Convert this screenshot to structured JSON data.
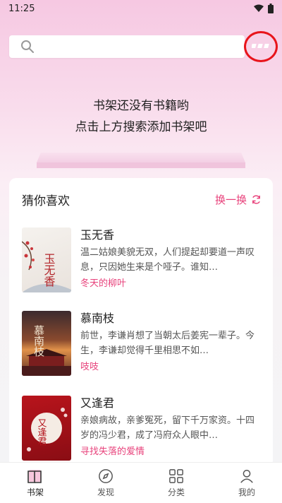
{
  "status": {
    "time": "11:25"
  },
  "search": {
    "placeholder": ""
  },
  "empty_state": {
    "line1": "书架还没有书籍哟",
    "line2": "点击上方搜索添加书架吧"
  },
  "recommend": {
    "title": "猜你喜欢",
    "refresh_label": "换一换",
    "books": [
      {
        "title": "玉无香",
        "desc": "温二姑娘美貌无双，人们提起却要道一声叹息，只因她生来是个哑子。谁知…",
        "author": "冬天的柳叶",
        "cover_text": "玉无香"
      },
      {
        "title": "慕南枝",
        "desc": "前世，李谦肖想了当朝太后姜宪一辈子。今生，李谦却觉得千里相思不如…",
        "author": "吱吱",
        "cover_text": "慕南枝"
      },
      {
        "title": "又逢君",
        "desc": "亲娘病故，亲爹冤死，留下千万家资。十四岁的冯少君，成了冯府众人眼中…",
        "author": "寻找失落的爱情",
        "cover_text": "又逢君"
      }
    ]
  },
  "tabs": [
    {
      "label": "书架",
      "icon": "book-icon",
      "active": true
    },
    {
      "label": "发现",
      "icon": "compass-icon",
      "active": false
    },
    {
      "label": "分类",
      "icon": "grid-icon",
      "active": false
    },
    {
      "label": "我的",
      "icon": "user-icon",
      "active": false
    }
  ],
  "colors": {
    "accent": "#e8437c",
    "highlight_circle": "#e8141b"
  }
}
